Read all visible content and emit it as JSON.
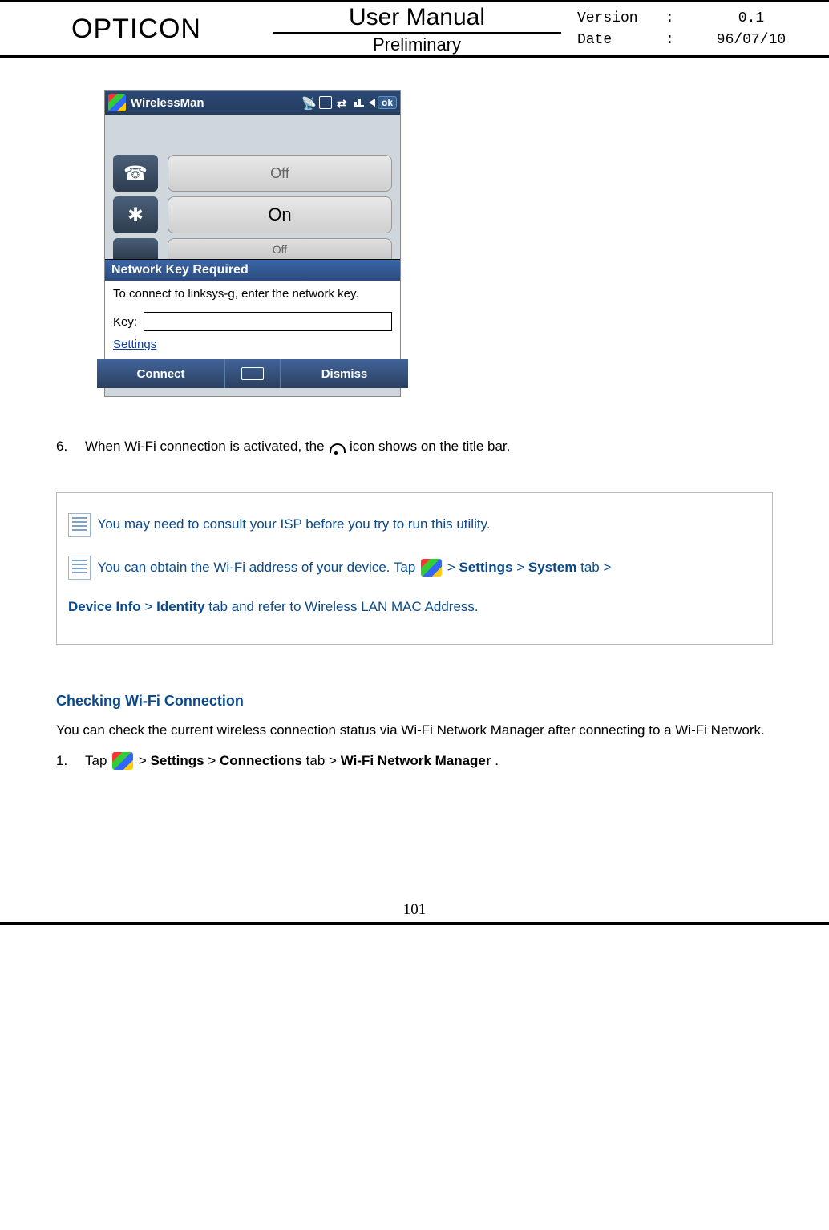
{
  "header": {
    "brand": "OPTICON",
    "title": "User Manual",
    "subtitle": "Preliminary",
    "version_label": "Version",
    "version_value": "0.1",
    "date_label": "Date",
    "date_value": "96/07/10",
    "colon": ":"
  },
  "phone": {
    "title": "WirelessMan",
    "ok": "ok",
    "rows": [
      {
        "icon": "☎",
        "state": "Off"
      },
      {
        "icon": "✱",
        "state": "On"
      },
      {
        "icon": " ",
        "state": "Off"
      }
    ],
    "modal_title": "Network Key Required",
    "modal_body": "To connect to linksys-g, enter the network key.",
    "key_label": "Key:",
    "settings": "Settings",
    "connect": "Connect",
    "dismiss": "Dismiss"
  },
  "step6": {
    "num": "6.",
    "text_before": "When Wi-Fi connection is activated, the ",
    "text_after": " icon shows on the title bar."
  },
  "notes": {
    "line1": "You may need to consult your ISP before you try to run this utility.",
    "line2_before": "You can obtain the Wi-Fi address of your device. Tap ",
    "line2_path1_a": "Settings",
    "line2_path1_b": "System",
    "line2_tab": " tab > ",
    "line3_a": "Device Info",
    "line3_b": "Identity",
    "line3_text": " tab and refer to Wireless LAN MAC Address."
  },
  "section": {
    "heading": "Checking Wi-Fi Connection",
    "body": "You can check the current wireless connection status via Wi-Fi Network Manager after connecting to a Wi-Fi Network."
  },
  "step1": {
    "num": "1.",
    "tap": "Tap ",
    "gt": " > ",
    "settings": "Settings",
    "connections": "Connections",
    "tab": " tab > ",
    "target": "Wi-Fi Network Manager",
    "period": "."
  },
  "page_number": "101"
}
